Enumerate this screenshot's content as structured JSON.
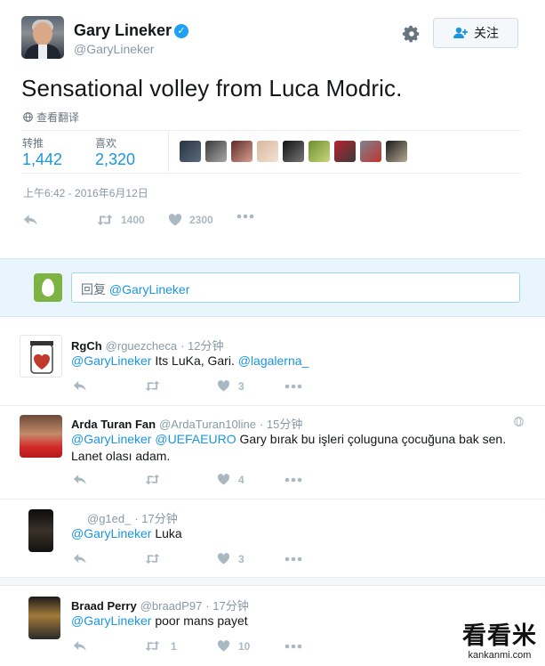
{
  "author": {
    "name": "Gary Lineker",
    "handle": "@GaryLineker"
  },
  "follow_label": "关注",
  "tweet": {
    "text": "Sensational volley from Luca Modric.",
    "translate": "查看翻译",
    "stats": [
      {
        "label": "转推",
        "value": "1,442"
      },
      {
        "label": "喜欢",
        "value": "2,320"
      }
    ],
    "timestamp": "上午6:42 - 2016年6月12日",
    "retweets": "1400",
    "likes": "2300"
  },
  "reply_box": {
    "prefix": "回复",
    "mention": "@GaryLineker"
  },
  "replies": [
    {
      "name": "RgCh",
      "handle": "@rguezcheca",
      "time": "· 12分钟",
      "mention": "@GaryLineker",
      "text": "Its LuKa, Gari.",
      "mention2": "@lagalerna_",
      "retweets": "",
      "likes": "3"
    },
    {
      "name": "Arda Turan Fan",
      "handle": "@ArdaTuran10line",
      "time": "· 15分钟",
      "mention": "@GaryLineker",
      "mention2": "@UEFAEURO",
      "text": "Gary bırak bu işleri çoluguna çocuğuna bak sen.",
      "text2": "Lanet olası adam.",
      "retweets": "",
      "likes": "4"
    },
    {
      "name": "",
      "handle": "@g1ed_",
      "time": "· 17分钟",
      "mention": "@GaryLineker",
      "text": "Luka",
      "retweets": "",
      "likes": "3"
    },
    {
      "name": "Braad Perry",
      "handle": "@braadP97",
      "time": "· 17分钟",
      "mention": "@GaryLineker",
      "text": "poor mans payet",
      "retweets": "1",
      "likes": "10"
    }
  ],
  "watermark": {
    "title": "看看米",
    "url": "kankanmi.com"
  },
  "colors": {
    "accent": "#1b95e0",
    "muted": "#8899a6",
    "reply_bg": "#e8f5fd",
    "like": "#aab8c2"
  },
  "icons": [
    "verified-icon",
    "gear-icon",
    "follow-user-icon",
    "globe-icon",
    "reply-icon",
    "retweet-icon",
    "heart-icon",
    "more-icon"
  ]
}
